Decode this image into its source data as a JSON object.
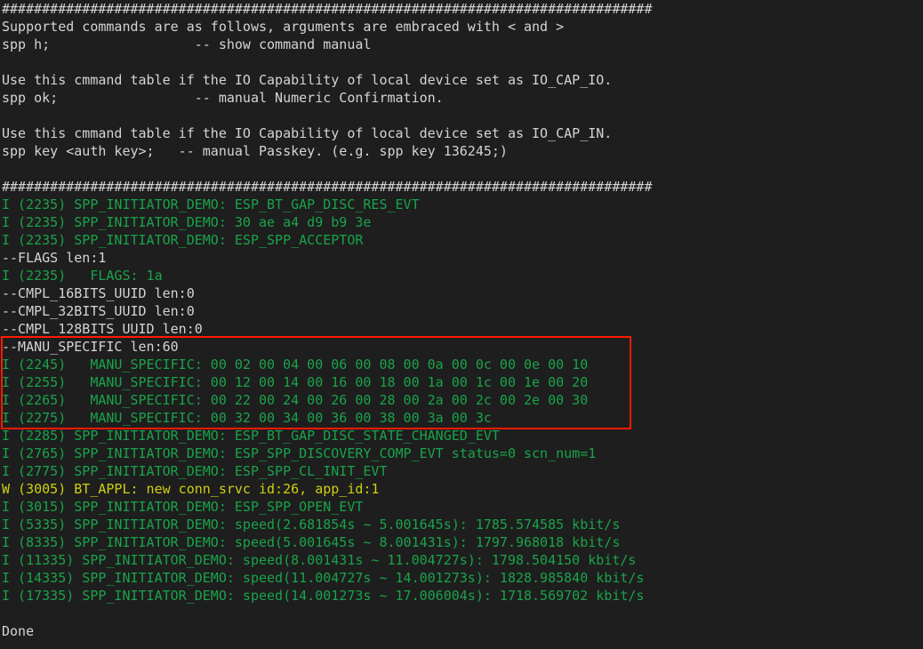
{
  "terminal": {
    "background_color": "#1e1e1e",
    "default_text_color": "#d4d4d4",
    "info_color": "#1aa34a",
    "warning_color": "#cfcf12",
    "highlight_border_color": "#ff1a00",
    "lines": [
      {
        "text": "#################################################################################",
        "color": "white"
      },
      {
        "text": "Supported commands are as follows, arguments are embraced with < and >",
        "color": "white"
      },
      {
        "text": "spp h;                  -- show command manual",
        "color": "white"
      },
      {
        "text": "",
        "color": "white"
      },
      {
        "text": "Use this cmmand table if the IO Capability of local device set as IO_CAP_IO.",
        "color": "white"
      },
      {
        "text": "spp ok;                 -- manual Numeric Confirmation.",
        "color": "white"
      },
      {
        "text": "",
        "color": "white"
      },
      {
        "text": "Use this cmmand table if the IO Capability of local device set as IO_CAP_IN.",
        "color": "white"
      },
      {
        "text": "spp key <auth key>;   -- manual Passkey. (e.g. spp key 136245;)",
        "color": "white"
      },
      {
        "text": "",
        "color": "white"
      },
      {
        "text": "#################################################################################",
        "color": "white"
      },
      {
        "text": "I (2235) SPP_INITIATOR_DEMO: ESP_BT_GAP_DISC_RES_EVT",
        "color": "green"
      },
      {
        "text": "I (2235) SPP_INITIATOR_DEMO: 30 ae a4 d9 b9 3e",
        "color": "green"
      },
      {
        "text": "I (2235) SPP_INITIATOR_DEMO: ESP_SPP_ACCEPTOR",
        "color": "green"
      },
      {
        "text": "--FLAGS len:1",
        "color": "white"
      },
      {
        "text": "I (2235)   FLAGS: 1a",
        "color": "green"
      },
      {
        "text": "--CMPL_16BITS_UUID len:0",
        "color": "white"
      },
      {
        "text": "--CMPL_32BITS_UUID len:0",
        "color": "white"
      },
      {
        "text": "--CMPL_128BITS_UUID len:0",
        "color": "white"
      },
      {
        "text": "--MANU_SPECIFIC len:60",
        "color": "white"
      },
      {
        "text": "I (2245)   MANU_SPECIFIC: 00 02 00 04 00 06 00 08 00 0a 00 0c 00 0e 00 10",
        "color": "green"
      },
      {
        "text": "I (2255)   MANU_SPECIFIC: 00 12 00 14 00 16 00 18 00 1a 00 1c 00 1e 00 20",
        "color": "green"
      },
      {
        "text": "I (2265)   MANU_SPECIFIC: 00 22 00 24 00 26 00 28 00 2a 00 2c 00 2e 00 30",
        "color": "green"
      },
      {
        "text": "I (2275)   MANU_SPECIFIC: 00 32 00 34 00 36 00 38 00 3a 00 3c",
        "color": "green"
      },
      {
        "text": "I (2285) SPP_INITIATOR_DEMO: ESP_BT_GAP_DISC_STATE_CHANGED_EVT",
        "color": "green"
      },
      {
        "text": "I (2765) SPP_INITIATOR_DEMO: ESP_SPP_DISCOVERY_COMP_EVT status=0 scn_num=1",
        "color": "green"
      },
      {
        "text": "I (2775) SPP_INITIATOR_DEMO: ESP_SPP_CL_INIT_EVT",
        "color": "green"
      },
      {
        "text": "W (3005) BT_APPL: new conn_srvc id:26, app_id:1",
        "color": "yellow"
      },
      {
        "text": "I (3015) SPP_INITIATOR_DEMO: ESP_SPP_OPEN_EVT",
        "color": "green"
      },
      {
        "text": "I (5335) SPP_INITIATOR_DEMO: speed(2.681854s ~ 5.001645s): 1785.574585 kbit/s",
        "color": "green"
      },
      {
        "text": "I (8335) SPP_INITIATOR_DEMO: speed(5.001645s ~ 8.001431s): 1797.968018 kbit/s",
        "color": "green"
      },
      {
        "text": "I (11335) SPP_INITIATOR_DEMO: speed(8.001431s ~ 11.004727s): 1798.504150 kbit/s",
        "color": "green"
      },
      {
        "text": "I (14335) SPP_INITIATOR_DEMO: speed(11.004727s ~ 14.001273s): 1828.985840 kbit/s",
        "color": "green"
      },
      {
        "text": "I (17335) SPP_INITIATOR_DEMO: speed(14.001273s ~ 17.006004s): 1718.569702 kbit/s",
        "color": "green"
      },
      {
        "text": "",
        "color": "white"
      },
      {
        "text": "Done",
        "color": "white"
      }
    ],
    "highlight": {
      "label": "manu-specific-highlight",
      "starts_at_line": 19,
      "ends_at_line": 23
    }
  }
}
